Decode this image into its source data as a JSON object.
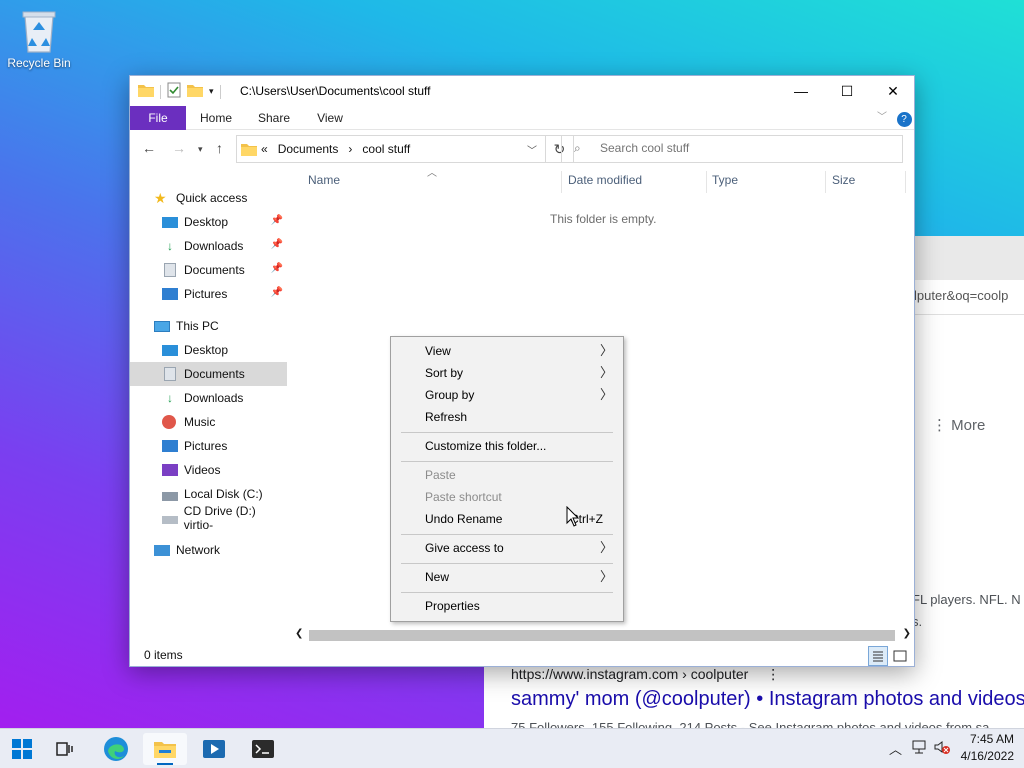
{
  "desktop": {
    "recycle_bin_label": "Recycle Bin"
  },
  "browser": {
    "address_fragment": "lputer&oq=coolp",
    "more_label": "More",
    "snippet_line1": "FL players. NFL. N",
    "snippet_line2": "s.",
    "result": {
      "url": "https://www.instagram.com › coolputer",
      "title": "sammy' mom (@coolputer) • Instagram photos and videos",
      "description": "75 Followers, 155 Following, 214 Posts - See Instagram photos and videos from sa"
    },
    "result_handle": "(@coolputer)"
  },
  "explorer": {
    "title_path": "C:\\Users\\User\\Documents\\cool stuff",
    "window_controls": {
      "minimize": "—",
      "maximize": "☐",
      "close": "✕"
    },
    "ribbon_tabs": [
      "File",
      "Home",
      "Share",
      "View"
    ],
    "breadcrumb": {
      "overflow": "«",
      "items": [
        "Documents",
        "cool stuff"
      ]
    },
    "search_placeholder": "Search cool stuff",
    "nav_pane": {
      "quick_access": "Quick access",
      "quick_items": [
        "Desktop",
        "Downloads",
        "Documents",
        "Pictures"
      ],
      "this_pc": "This PC",
      "pc_items": [
        "Desktop",
        "Documents",
        "Downloads",
        "Music",
        "Pictures",
        "Videos",
        "Local Disk (C:)",
        "CD Drive (D:) virtio-"
      ],
      "network": "Network",
      "selected": "Documents"
    },
    "columns": [
      "Name",
      "Date modified",
      "Type",
      "Size"
    ],
    "empty_message": "This folder is empty.",
    "status": "0 items"
  },
  "context_menu": {
    "items": [
      {
        "label": "View",
        "submenu": true
      },
      {
        "label": "Sort by",
        "submenu": true
      },
      {
        "label": "Group by",
        "submenu": true
      },
      {
        "label": "Refresh"
      },
      {
        "label": "Customize this folder..."
      },
      {
        "label": "Paste",
        "disabled": true
      },
      {
        "label": "Paste shortcut",
        "disabled": true
      },
      {
        "label": "Undo Rename",
        "shortcut": "Ctrl+Z"
      },
      {
        "label": "Give access to",
        "submenu": true
      },
      {
        "label": "New",
        "submenu": true
      },
      {
        "label": "Properties"
      }
    ]
  },
  "taskbar": {
    "apps": [
      "start-icon",
      "task-view-icon",
      "edge-icon",
      "file-explorer-icon",
      "media-app-icon",
      "terminal-icon"
    ],
    "active": "file-explorer-icon",
    "time": "7:45 AM",
    "date": "4/16/2022"
  },
  "colors": {
    "file_tab": "#6b2fbf",
    "accent": "#0067c0",
    "link": "#1a0dab"
  }
}
